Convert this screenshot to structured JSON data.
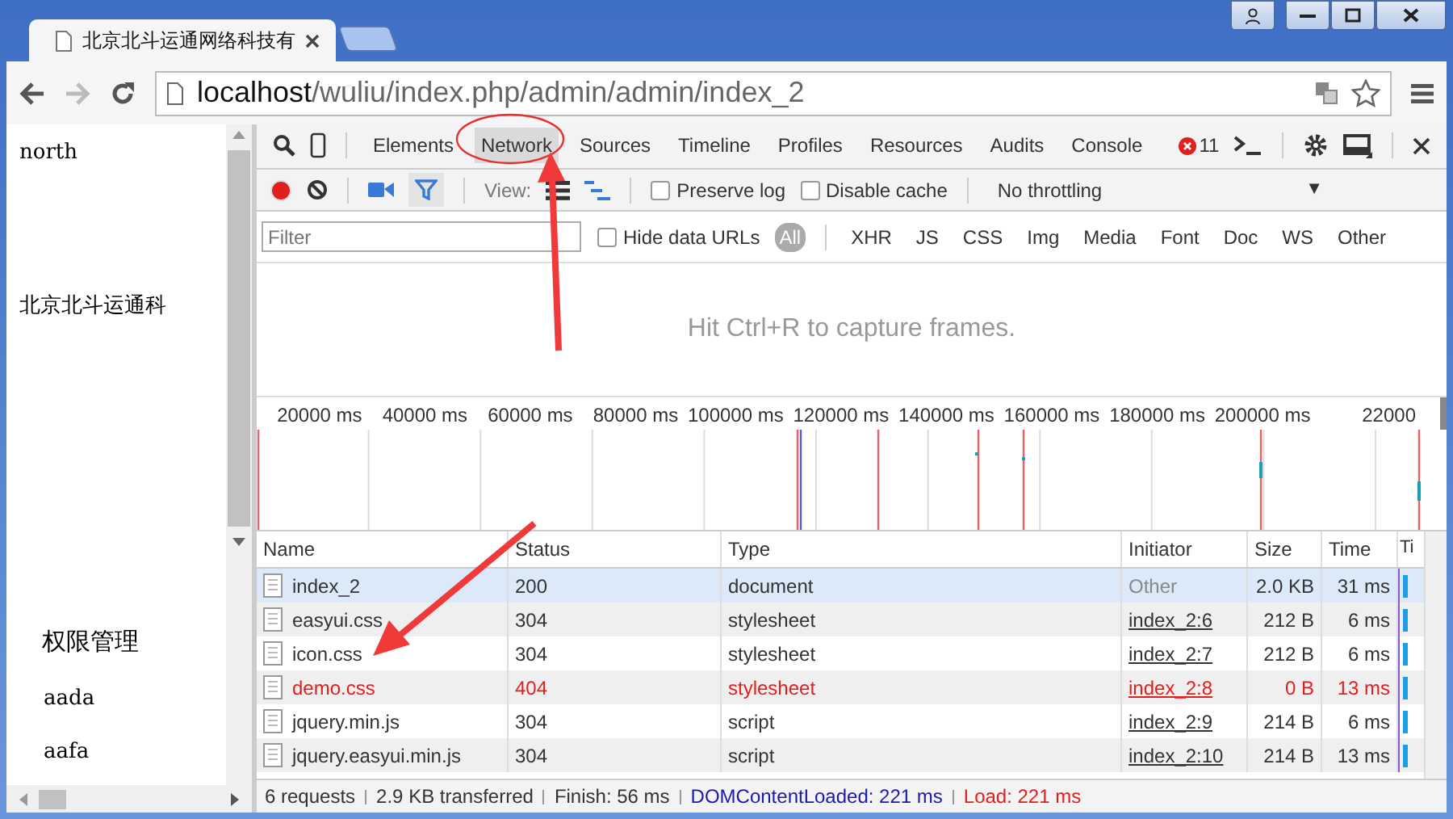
{
  "browser": {
    "tab_title": "北京北斗运通网络科技有",
    "url_host": "localhost",
    "url_path": "/wuliu/index.php/admin/admin/index_2"
  },
  "page": {
    "texts": [
      {
        "kind": "plain",
        "text": "north"
      },
      {
        "kind": "plain",
        "text": "北京北斗运通科"
      },
      {
        "kind": "heading",
        "text": "权限管理"
      },
      {
        "kind": "item",
        "text": "aada"
      },
      {
        "kind": "item",
        "text": "aafa"
      }
    ]
  },
  "devtools": {
    "tabs": [
      {
        "label": "Elements",
        "selected": false
      },
      {
        "label": "Network",
        "selected": true
      },
      {
        "label": "Sources",
        "selected": false
      },
      {
        "label": "Timeline",
        "selected": false
      },
      {
        "label": "Profiles",
        "selected": false
      },
      {
        "label": "Resources",
        "selected": false
      },
      {
        "label": "Audits",
        "selected": false
      },
      {
        "label": "Console",
        "selected": false
      }
    ],
    "error_count": "11",
    "recording": true,
    "view_label": "View:",
    "options": [
      {
        "label": "Preserve log",
        "checked": false
      },
      {
        "label": "Disable cache",
        "checked": false
      }
    ],
    "throttling": {
      "value": "No throttling",
      "caret": "▼"
    },
    "filter": {
      "placeholder": "Filter"
    },
    "hide_data_urls": {
      "label": "Hide data URLs",
      "checked": false
    },
    "type_filters": [
      {
        "label": "All",
        "selected": true
      },
      {
        "label": "XHR",
        "selected": false
      },
      {
        "label": "JS",
        "selected": false
      },
      {
        "label": "CSS",
        "selected": false
      },
      {
        "label": "Img",
        "selected": false
      },
      {
        "label": "Media",
        "selected": false
      },
      {
        "label": "Font",
        "selected": false
      },
      {
        "label": "Doc",
        "selected": false
      },
      {
        "label": "WS",
        "selected": false
      },
      {
        "label": "Other",
        "selected": false
      }
    ],
    "frames_message": "Hit Ctrl+R to capture frames.",
    "timeline_ticks": [
      "20000 ms",
      "40000 ms",
      "60000 ms",
      "80000 ms",
      "100000 ms",
      "120000 ms",
      "140000 ms",
      "160000 ms",
      "180000 ms",
      "200000 ms",
      "22000"
    ],
    "columns": [
      "Name",
      "Status",
      "Type",
      "Initiator",
      "Size",
      "Time",
      "Ti"
    ],
    "rows": [
      {
        "name": "index_2",
        "status": "200",
        "type": "document",
        "initiator": "Other",
        "initiator_link": false,
        "size": "2.0 KB",
        "time": "31 ms",
        "error": false,
        "selected": true
      },
      {
        "name": "easyui.css",
        "status": "304",
        "type": "stylesheet",
        "initiator": "index_2:6",
        "initiator_link": true,
        "size": "212 B",
        "time": "6 ms",
        "error": false,
        "selected": false
      },
      {
        "name": "icon.css",
        "status": "304",
        "type": "stylesheet",
        "initiator": "index_2:7",
        "initiator_link": true,
        "size": "212 B",
        "time": "6 ms",
        "error": false,
        "selected": false
      },
      {
        "name": "demo.css",
        "status": "404",
        "type": "stylesheet",
        "initiator": "index_2:8",
        "initiator_link": true,
        "size": "0 B",
        "time": "13 ms",
        "error": true,
        "selected": false
      },
      {
        "name": "jquery.min.js",
        "status": "304",
        "type": "script",
        "initiator": "index_2:9",
        "initiator_link": true,
        "size": "214 B",
        "time": "6 ms",
        "error": false,
        "selected": false
      },
      {
        "name": "jquery.easyui.min.js",
        "status": "304",
        "type": "script",
        "initiator": "index_2:10",
        "initiator_link": true,
        "size": "214 B",
        "time": "13 ms",
        "error": false,
        "selected": false
      }
    ],
    "summary": [
      {
        "text": "6 requests",
        "color": "#333333"
      },
      {
        "text": "2.9 KB transferred",
        "color": "#333333"
      },
      {
        "text": "Finish: 56 ms",
        "color": "#333333"
      },
      {
        "text": "DOMContentLoaded: 221 ms",
        "color": "#1a1aa6"
      },
      {
        "text": "Load: 221 ms",
        "color": "#e0201f"
      }
    ]
  }
}
